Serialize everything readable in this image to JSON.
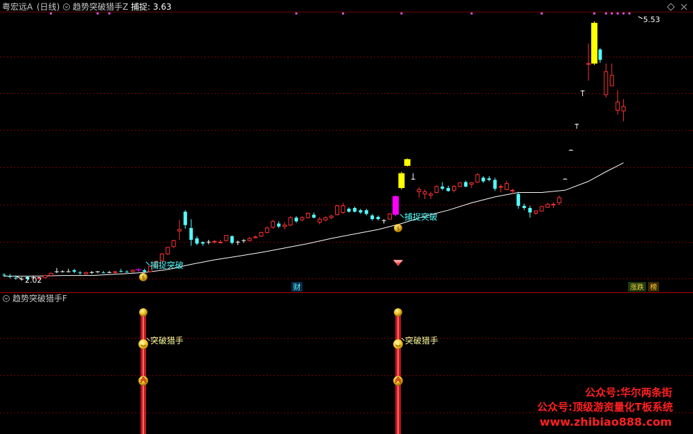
{
  "main_panel": {
    "stock_name": "粤宏远A",
    "period": "(日线)",
    "indicator_name": "趋势突破猎手Z",
    "capture_label": "捕捉:",
    "capture_value": "3.63"
  },
  "sub_panel": {
    "indicator_name": "趋势突破猎手F"
  },
  "annotations": {
    "low_price": "2.02",
    "high_price": "5.53",
    "capture_breakout": "捕捉突破",
    "breakout_hunter": "突破猎手",
    "cai_badge": "财",
    "zhangdie_badge": "涨跌",
    "bang_badge": "榜"
  },
  "watermark": {
    "line1": "公众号:华尔两条街",
    "line2": "公众号:顶级游资量化T板系统",
    "line3": "www.zhibiao888.com"
  },
  "colors": {
    "up": "#ff3232",
    "down": "#54ffff",
    "signal_yellow": "#ffff00",
    "signal_magenta": "#ff00ff",
    "ma_line": "#ffffff",
    "grid": "#7a0000",
    "title_text": "#c8c8c8",
    "label_text": "#54ffff",
    "watermark": "#ff2020"
  },
  "chart_data": {
    "type": "candlestick",
    "price_range": [
      1.9,
      5.65
    ],
    "candles": [
      {
        "o": 2.1,
        "h": 2.13,
        "l": 2.08,
        "c": 2.11,
        "style": "down"
      },
      {
        "o": 2.09,
        "h": 2.12,
        "l": 2.06,
        "c": 2.08,
        "style": "down"
      },
      {
        "o": 2.07,
        "h": 2.1,
        "l": 2.04,
        "c": 2.06,
        "style": "down"
      },
      {
        "o": 2.05,
        "h": 2.08,
        "l": 2.03,
        "c": 2.05,
        "style": "cross"
      },
      {
        "o": 2.05,
        "h": 2.09,
        "l": 2.04,
        "c": 2.08,
        "style": "down"
      },
      {
        "o": 2.07,
        "h": 2.1,
        "l": 2.05,
        "c": 2.07,
        "style": "cross"
      },
      {
        "o": 2.06,
        "h": 2.08,
        "l": 2.04,
        "c": 2.07,
        "style": "up"
      },
      {
        "o": 2.07,
        "h": 2.11,
        "l": 2.06,
        "c": 2.1,
        "style": "up"
      },
      {
        "o": 2.1,
        "h": 2.14,
        "l": 2.09,
        "c": 2.13,
        "style": "up"
      },
      {
        "o": 2.15,
        "h": 2.2,
        "l": 2.13,
        "c": 2.15,
        "style": "cross"
      },
      {
        "o": 2.15,
        "h": 2.17,
        "l": 2.14,
        "c": 2.15,
        "style": "cross"
      },
      {
        "o": 2.15,
        "h": 2.19,
        "l": 2.14,
        "c": 2.15,
        "style": "cross"
      },
      {
        "o": 2.17,
        "h": 2.19,
        "l": 2.13,
        "c": 2.15,
        "style": "down"
      },
      {
        "o": 2.14,
        "h": 2.16,
        "l": 2.11,
        "c": 2.13,
        "style": "down"
      },
      {
        "o": 2.12,
        "h": 2.15,
        "l": 2.11,
        "c": 2.14,
        "style": "up"
      },
      {
        "o": 2.14,
        "h": 2.16,
        "l": 2.12,
        "c": 2.14,
        "style": "cross"
      },
      {
        "o": 2.14,
        "h": 2.16,
        "l": 2.13,
        "c": 2.15,
        "style": "cross"
      },
      {
        "o": 2.14,
        "h": 2.16,
        "l": 2.13,
        "c": 2.14,
        "style": "down"
      },
      {
        "o": 2.14,
        "h": 2.16,
        "l": 2.13,
        "c": 2.14,
        "style": "cross"
      },
      {
        "o": 2.14,
        "h": 2.16,
        "l": 2.12,
        "c": 2.15,
        "style": "up"
      },
      {
        "o": 2.16,
        "h": 2.19,
        "l": 2.14,
        "c": 2.15,
        "style": "down"
      },
      {
        "o": 2.15,
        "h": 2.17,
        "l": 2.14,
        "c": 2.15,
        "style": "down"
      },
      {
        "o": 2.15,
        "h": 2.18,
        "l": 2.14,
        "c": 2.17,
        "style": "up"
      },
      {
        "o": 2.17,
        "h": 2.2,
        "l": 2.15,
        "c": 2.18,
        "style": "magenta"
      },
      {
        "o": 2.17,
        "h": 2.19,
        "l": 2.14,
        "c": 2.15,
        "style": "down"
      },
      {
        "o": 2.15,
        "h": 2.23,
        "l": 2.14,
        "c": 2.22,
        "style": "up"
      },
      {
        "o": 2.22,
        "h": 2.3,
        "l": 2.21,
        "c": 2.29,
        "style": "up"
      },
      {
        "o": 2.3,
        "h": 2.4,
        "l": 2.29,
        "c": 2.39,
        "style": "up"
      },
      {
        "o": 2.39,
        "h": 2.48,
        "l": 2.38,
        "c": 2.48,
        "style": "up"
      },
      {
        "o": 2.49,
        "h": 2.58,
        "l": 2.47,
        "c": 2.57,
        "style": "up"
      },
      {
        "o": 2.72,
        "h": 2.85,
        "l": 2.58,
        "c": 2.7,
        "style": "up"
      },
      {
        "o": 2.96,
        "h": 2.98,
        "l": 2.73,
        "c": 2.78,
        "style": "down"
      },
      {
        "o": 2.74,
        "h": 2.86,
        "l": 2.5,
        "c": 2.58,
        "style": "down"
      },
      {
        "o": 2.6,
        "h": 2.63,
        "l": 2.51,
        "c": 2.53,
        "style": "down"
      },
      {
        "o": 2.53,
        "h": 2.56,
        "l": 2.5,
        "c": 2.55,
        "style": "down"
      },
      {
        "o": 2.55,
        "h": 2.58,
        "l": 2.52,
        "c": 2.55,
        "style": "cross"
      },
      {
        "o": 2.55,
        "h": 2.58,
        "l": 2.53,
        "c": 2.56,
        "style": "up"
      },
      {
        "o": 2.55,
        "h": 2.58,
        "l": 2.53,
        "c": 2.55,
        "style": "up"
      },
      {
        "o": 2.57,
        "h": 2.64,
        "l": 2.56,
        "c": 2.64,
        "style": "up"
      },
      {
        "o": 2.63,
        "h": 2.64,
        "l": 2.52,
        "c": 2.54,
        "style": "down"
      },
      {
        "o": 2.55,
        "h": 2.57,
        "l": 2.51,
        "c": 2.55,
        "style": "cross"
      },
      {
        "o": 2.56,
        "h": 2.59,
        "l": 2.54,
        "c": 2.57,
        "style": "cross"
      },
      {
        "o": 2.57,
        "h": 2.62,
        "l": 2.56,
        "c": 2.6,
        "style": "up"
      },
      {
        "o": 2.61,
        "h": 2.64,
        "l": 2.6,
        "c": 2.62,
        "style": "up"
      },
      {
        "o": 2.63,
        "h": 2.69,
        "l": 2.62,
        "c": 2.68,
        "style": "up"
      },
      {
        "o": 2.68,
        "h": 2.76,
        "l": 2.67,
        "c": 2.74,
        "style": "up"
      },
      {
        "o": 2.75,
        "h": 2.85,
        "l": 2.73,
        "c": 2.83,
        "style": "up"
      },
      {
        "o": 2.8,
        "h": 2.83,
        "l": 2.74,
        "c": 2.76,
        "style": "down"
      },
      {
        "o": 2.78,
        "h": 2.82,
        "l": 2.72,
        "c": 2.76,
        "style": "up"
      },
      {
        "o": 2.78,
        "h": 2.9,
        "l": 2.77,
        "c": 2.88,
        "style": "up"
      },
      {
        "o": 2.88,
        "h": 2.9,
        "l": 2.81,
        "c": 2.83,
        "style": "down"
      },
      {
        "o": 2.85,
        "h": 2.9,
        "l": 2.83,
        "c": 2.88,
        "style": "up"
      },
      {
        "o": 2.88,
        "h": 2.95,
        "l": 2.87,
        "c": 2.94,
        "style": "up"
      },
      {
        "o": 2.92,
        "h": 2.95,
        "l": 2.87,
        "c": 2.88,
        "style": "down"
      },
      {
        "o": 2.86,
        "h": 2.89,
        "l": 2.79,
        "c": 2.82,
        "style": "up"
      },
      {
        "o": 2.85,
        "h": 2.9,
        "l": 2.83,
        "c": 2.88,
        "style": "up"
      },
      {
        "o": 2.88,
        "h": 2.92,
        "l": 2.86,
        "c": 2.9,
        "style": "up"
      },
      {
        "o": 2.92,
        "h": 3.05,
        "l": 2.91,
        "c": 3.04,
        "style": "up"
      },
      {
        "o": 3.04,
        "h": 3.08,
        "l": 2.93,
        "c": 2.95,
        "style": "up"
      },
      {
        "o": 3.0,
        "h": 3.02,
        "l": 2.95,
        "c": 2.96,
        "style": "down"
      },
      {
        "o": 3.01,
        "h": 3.03,
        "l": 2.95,
        "c": 2.96,
        "style": "down"
      },
      {
        "o": 2.98,
        "h": 3.0,
        "l": 2.93,
        "c": 2.95,
        "style": "down"
      },
      {
        "o": 2.98,
        "h": 3.0,
        "l": 2.91,
        "c": 2.93,
        "style": "down"
      },
      {
        "o": 2.91,
        "h": 2.93,
        "l": 2.84,
        "c": 2.86,
        "style": "down"
      },
      {
        "o": 2.89,
        "h": 2.91,
        "l": 2.84,
        "c": 2.86,
        "style": "down"
      },
      {
        "o": 2.84,
        "h": 2.86,
        "l": 2.8,
        "c": 2.84,
        "style": "cross"
      },
      {
        "o": 2.86,
        "h": 2.94,
        "l": 2.85,
        "c": 2.93,
        "style": "up"
      },
      {
        "o": 2.92,
        "h": 3.18,
        "l": 2.9,
        "c": 3.17,
        "style": "magenta"
      },
      {
        "o": 3.28,
        "h": 3.5,
        "l": 3.26,
        "c": 3.48,
        "style": "yellow"
      },
      {
        "o": 3.58,
        "h": 3.68,
        "l": 3.57,
        "c": 3.67,
        "style": "yellow"
      },
      {
        "o": 3.4,
        "h": 3.48,
        "l": 3.39,
        "c": 3.4,
        "style": "t"
      },
      {
        "o": 3.26,
        "h": 3.29,
        "l": 3.15,
        "c": 3.23,
        "style": "up"
      },
      {
        "o": 3.23,
        "h": 3.26,
        "l": 3.13,
        "c": 3.2,
        "style": "up"
      },
      {
        "o": 3.2,
        "h": 3.23,
        "l": 3.13,
        "c": 3.18,
        "style": "up"
      },
      {
        "o": 3.22,
        "h": 3.32,
        "l": 3.21,
        "c": 3.3,
        "style": "up"
      },
      {
        "o": 3.3,
        "h": 3.36,
        "l": 3.25,
        "c": 3.27,
        "style": "down"
      },
      {
        "o": 3.28,
        "h": 3.31,
        "l": 3.23,
        "c": 3.24,
        "style": "down"
      },
      {
        "o": 3.25,
        "h": 3.32,
        "l": 3.22,
        "c": 3.3,
        "style": "up"
      },
      {
        "o": 3.3,
        "h": 3.36,
        "l": 3.29,
        "c": 3.35,
        "style": "up"
      },
      {
        "o": 3.36,
        "h": 3.38,
        "l": 3.29,
        "c": 3.3,
        "style": "down"
      },
      {
        "o": 3.33,
        "h": 3.36,
        "l": 3.28,
        "c": 3.35,
        "style": "up"
      },
      {
        "o": 3.36,
        "h": 3.48,
        "l": 3.35,
        "c": 3.46,
        "style": "up"
      },
      {
        "o": 3.42,
        "h": 3.44,
        "l": 3.35,
        "c": 3.37,
        "style": "down"
      },
      {
        "o": 3.39,
        "h": 3.44,
        "l": 3.37,
        "c": 3.41,
        "style": "down"
      },
      {
        "o": 3.39,
        "h": 3.42,
        "l": 3.24,
        "c": 3.27,
        "style": "down"
      },
      {
        "o": 3.29,
        "h": 3.33,
        "l": 3.22,
        "c": 3.3,
        "style": "up"
      },
      {
        "o": 3.26,
        "h": 3.38,
        "l": 3.25,
        "c": 3.34,
        "style": "up"
      },
      {
        "o": 3.24,
        "h": 3.27,
        "l": 3.2,
        "c": 3.25,
        "style": "up"
      },
      {
        "o": 3.2,
        "h": 3.23,
        "l": 3.0,
        "c": 3.04,
        "style": "down"
      },
      {
        "o": 3.04,
        "h": 3.07,
        "l": 2.98,
        "c": 3.01,
        "style": "down"
      },
      {
        "o": 3.01,
        "h": 3.04,
        "l": 2.88,
        "c": 2.95,
        "style": "down"
      },
      {
        "o": 2.94,
        "h": 2.98,
        "l": 2.92,
        "c": 2.97,
        "style": "up"
      },
      {
        "o": 2.97,
        "h": 3.04,
        "l": 2.96,
        "c": 3.03,
        "style": "up"
      },
      {
        "o": 3.02,
        "h": 3.08,
        "l": 3.01,
        "c": 3.06,
        "style": "up"
      },
      {
        "o": 3.05,
        "h": 3.09,
        "l": 3.01,
        "c": 3.06,
        "style": "up"
      },
      {
        "o": 3.08,
        "h": 3.18,
        "l": 3.05,
        "c": 3.15,
        "style": "up"
      },
      {
        "o": 3.4,
        "h": 3.41,
        "l": 3.4,
        "c": 3.4,
        "style": "t"
      },
      {
        "o": 3.79,
        "h": 3.8,
        "l": 3.79,
        "c": 3.79,
        "style": "t"
      },
      {
        "o": 4.14,
        "h": 4.15,
        "l": 4.08,
        "c": 4.14,
        "style": "t"
      },
      {
        "o": 4.59,
        "h": 4.6,
        "l": 4.52,
        "c": 4.59,
        "style": "t"
      },
      {
        "o": 4.95,
        "h": 5.23,
        "l": 4.73,
        "c": 4.96,
        "style": "up"
      },
      {
        "o": 4.96,
        "h": 5.53,
        "l": 4.94,
        "c": 5.51,
        "style": "yellow"
      },
      {
        "o": 5.15,
        "h": 5.17,
        "l": 4.97,
        "c": 5.01,
        "style": "down"
      },
      {
        "o": 4.85,
        "h": 4.96,
        "l": 4.5,
        "c": 4.54,
        "style": "up"
      },
      {
        "o": 4.8,
        "h": 4.96,
        "l": 4.67,
        "c": 4.66,
        "style": "up"
      },
      {
        "o": 4.33,
        "h": 4.6,
        "l": 4.27,
        "c": 4.44,
        "style": "up"
      },
      {
        "o": 4.32,
        "h": 4.48,
        "l": 4.18,
        "c": 4.38,
        "style": "up"
      }
    ],
    "ma": [
      [
        0,
        2.09
      ],
      [
        5,
        2.09
      ],
      [
        10,
        2.1
      ],
      [
        15,
        2.1
      ],
      [
        20,
        2.12
      ],
      [
        24,
        2.14
      ],
      [
        28,
        2.18
      ],
      [
        32,
        2.25
      ],
      [
        36,
        2.31
      ],
      [
        40,
        2.36
      ],
      [
        44,
        2.41
      ],
      [
        48,
        2.47
      ],
      [
        52,
        2.53
      ],
      [
        56,
        2.6
      ],
      [
        60,
        2.66
      ],
      [
        64,
        2.72
      ],
      [
        68,
        2.8
      ],
      [
        72,
        2.9
      ],
      [
        76,
        2.98
      ],
      [
        80,
        3.08
      ],
      [
        84,
        3.16
      ],
      [
        88,
        3.22
      ],
      [
        92,
        3.22
      ],
      [
        96,
        3.25
      ],
      [
        100,
        3.37
      ],
      [
        103,
        3.5
      ],
      [
        106,
        3.62
      ]
    ],
    "sub_signals": [
      24,
      68
    ]
  }
}
